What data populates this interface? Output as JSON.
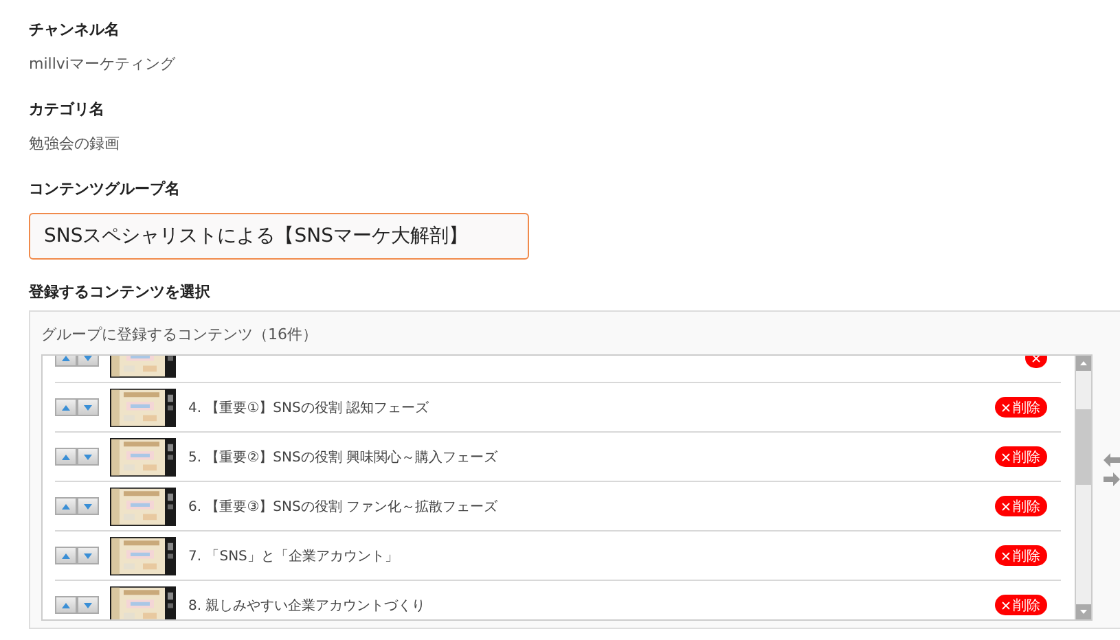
{
  "fields": [
    {
      "label": "チャンネル名",
      "value": "millviマーケティング"
    },
    {
      "label": "カテゴリ名",
      "value": "勉強会の録画"
    }
  ],
  "group_name": {
    "label": "コンテンツグループ名",
    "value": "SNSスペシャリストによる【SNSマーケ大解剖】"
  },
  "select": {
    "label": "登録するコンテンツを選択",
    "panel_title": "グループに登録するコンテンツ（16件）",
    "items": [
      {
        "title": "4. 【重要①】SNSの役割 認知フェーズ",
        "delete": "削除"
      },
      {
        "title": "5. 【重要②】SNSの役割 興味関心～購入フェーズ",
        "delete": "削除"
      },
      {
        "title": "6. 【重要③】SNSの役割 ファン化～拡散フェーズ",
        "delete": "削除"
      },
      {
        "title": "7. 「SNS」と「企業アカウント」",
        "delete": "削除"
      },
      {
        "title": "8. 親しみやすい企業アカウントづくり",
        "delete": "削除"
      }
    ]
  }
}
